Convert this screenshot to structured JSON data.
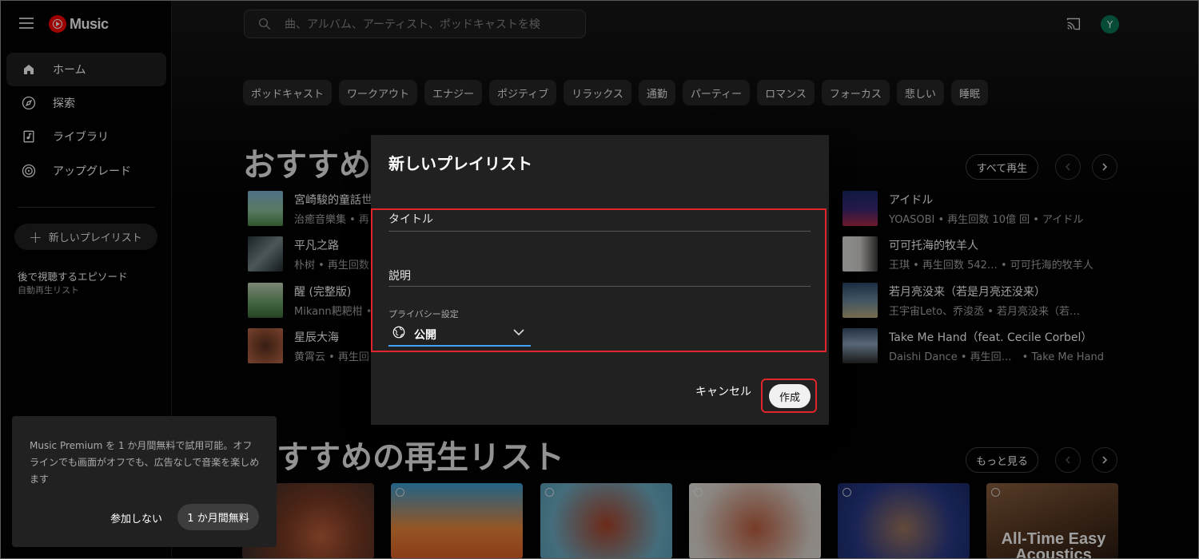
{
  "app": {
    "logo_text": "Music",
    "avatar_letter": "Y"
  },
  "search": {
    "placeholder": "曲、アルバム、アーティスト、ポッドキャストを検"
  },
  "sidebar": {
    "items": [
      {
        "label": "ホーム",
        "icon": "home-icon",
        "active": true
      },
      {
        "label": "探索",
        "icon": "compass-icon"
      },
      {
        "label": "ライブラリ",
        "icon": "library-icon"
      },
      {
        "label": "アップグレード",
        "icon": "upgrade-icon"
      }
    ],
    "new_playlist": "新しいプレイリスト",
    "playlist_title": "後で視聴するエピソード",
    "playlist_sub": "自動再生リスト"
  },
  "chips": [
    "ポッドキャスト",
    "ワークアウト",
    "エナジー",
    "ポジティブ",
    "リラックス",
    "通勤",
    "パーティー",
    "ロマンス",
    "フォーカス",
    "悲しい",
    "睡眠"
  ],
  "recommended": {
    "title": "おすすめ",
    "play_all": "すべて再生",
    "left_column": [
      {
        "title": "宮崎駿的童話世",
        "meta": "治癒音樂集 • 再"
      },
      {
        "title": "平凡之路",
        "meta": "朴树 • 再生回数"
      },
      {
        "title": "醒 (完整版)",
        "meta": "Mikann耙耙柑 •"
      },
      {
        "title": "星辰大海",
        "meta": "黄霄云 • 再生回"
      }
    ],
    "right_column": [
      {
        "title": "アイドル",
        "meta": "YOASOBI • 再生回数 10億 回 • アイドル"
      },
      {
        "title": "可可托海的牧羊人",
        "meta": "王琪 • 再生回数 542… • 可可托海的牧羊人"
      },
      {
        "title": "若月亮没来（若是月亮还没来）",
        "meta": "王宇宙Leto、乔浚丞 • 若月亮没来（若…"
      },
      {
        "title": "Take Me Hand（feat. Cecile Corbel）",
        "meta": "Daishi Dance • 再生回…　• Take Me Hand"
      }
    ]
  },
  "playlists": {
    "title": "すすめの再生リスト",
    "more": "もっと見る",
    "last_card_text": "All-Time Easy Acoustics"
  },
  "dialog": {
    "title": "新しいプレイリスト",
    "title_field": "タイトル",
    "description_field": "説明",
    "privacy_label": "プライバシー設定",
    "privacy_value": "公開",
    "cancel": "キャンセル",
    "create": "作成"
  },
  "promo": {
    "text": "Music Premium を 1 か月間無料で試用可能。オフラインでも画面がオフでも、広告なしで音楽を楽しめます",
    "skip": "参加しない",
    "trial": "1 か月間無料"
  },
  "colors": {
    "accent_red": "#e1262b",
    "focus_blue": "#3ea6ff",
    "avatar_bg": "#0b7a5b"
  }
}
